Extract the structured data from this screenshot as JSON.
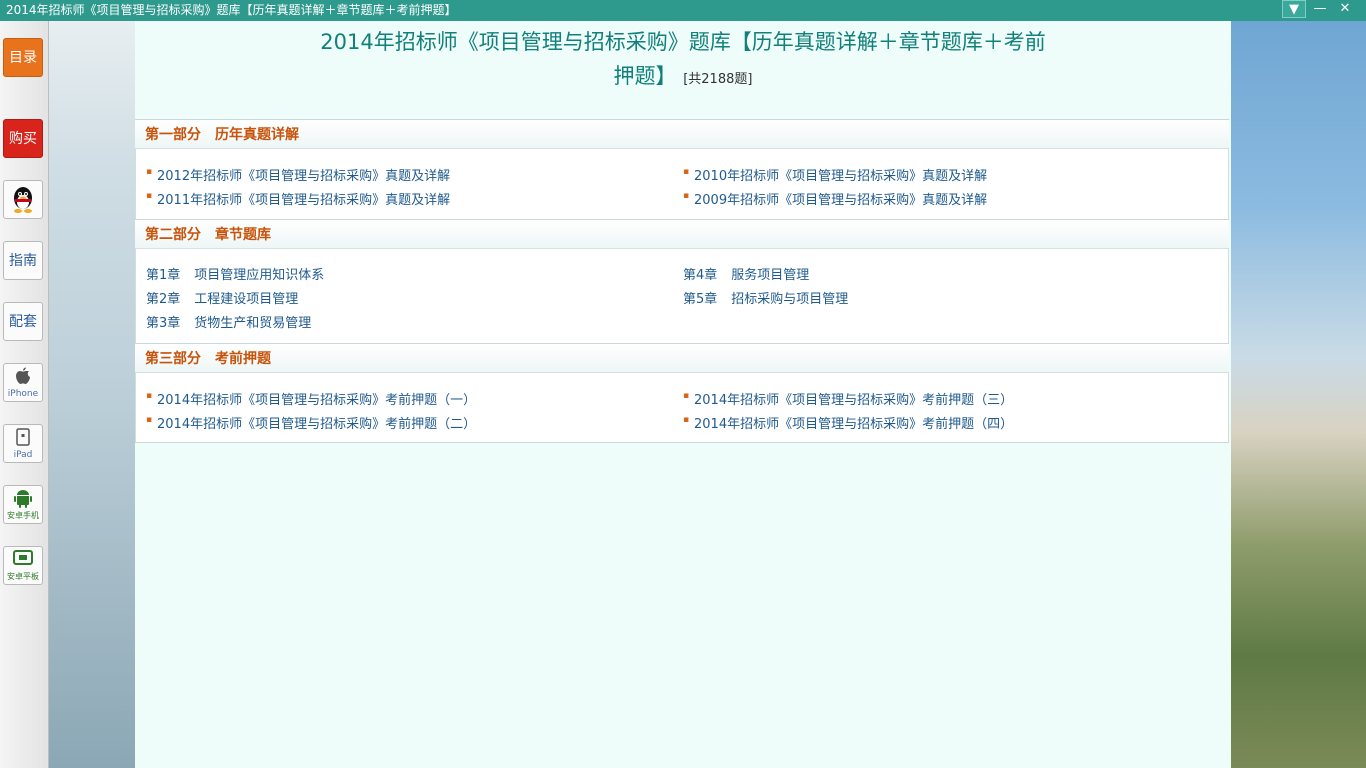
{
  "window": {
    "title": "2014年招标师《项目管理与招标采购》题库【历年真题详解＋章节题库＋考前押题】",
    "menu_icon": "▼",
    "min_icon": "—",
    "close_icon": "✕"
  },
  "sidebar": {
    "catalog": "目录",
    "buy": "购买",
    "qq_icon": "qq-penguin-icon",
    "guide": "指南",
    "bundle": "配套",
    "iphone": "iPhone",
    "ipad": "iPad",
    "android_phone": "安卓手机",
    "android_tablet": "安卓平板"
  },
  "page": {
    "title_line1": "2014年招标师《项目管理与招标采购》题库【历年真题详解＋章节题库＋考前",
    "title_line2": "押题】",
    "count": "[共2188题]"
  },
  "sections": [
    {
      "heading": "第一部分　历年真题详解",
      "items": [
        "2012年招标师《项目管理与招标采购》真题及详解",
        "2011年招标师《项目管理与招标采购》真题及详解",
        "2010年招标师《项目管理与招标采购》真题及详解",
        "2009年招标师《项目管理与招标采购》真题及详解"
      ]
    },
    {
      "heading": "第二部分　章节题库",
      "chapters": [
        {
          "num": "第1章",
          "name": "项目管理应用知识体系"
        },
        {
          "num": "第2章",
          "name": "工程建设项目管理"
        },
        {
          "num": "第3章",
          "name": "货物生产和贸易管理"
        },
        {
          "num": "第4章",
          "name": "服务项目管理"
        },
        {
          "num": "第5章",
          "name": "招标采购与项目管理"
        }
      ]
    },
    {
      "heading": "第三部分　考前押题",
      "items": [
        "2014年招标师《项目管理与招标采购》考前押题（一）",
        "2014年招标师《项目管理与招标采购》考前押题（二）",
        "2014年招标师《项目管理与招标采购》考前押题（三）",
        "2014年招标师《项目管理与招标采购》考前押题（四）"
      ]
    }
  ],
  "colors": {
    "titlebar": "#2e9a8e",
    "heading": "#c8530a",
    "link": "#1f5a8e",
    "main_title": "#11807a"
  }
}
